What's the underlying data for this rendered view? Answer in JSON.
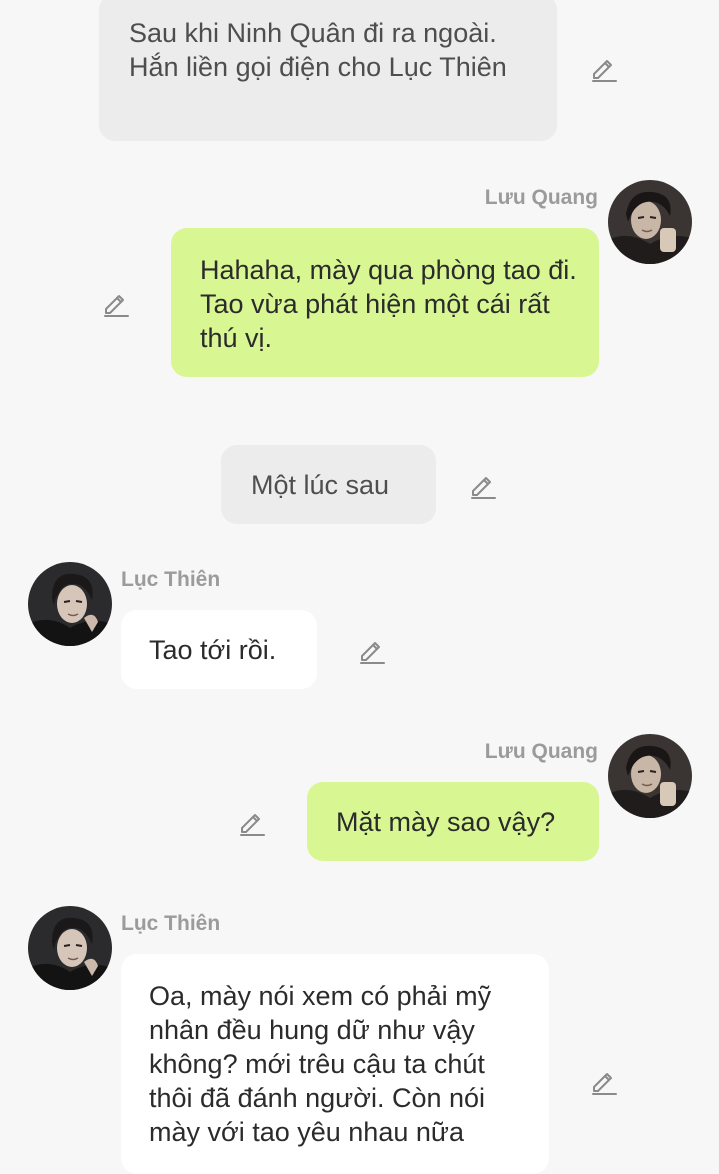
{
  "messages": [
    {
      "id": "narration-1",
      "type": "narration",
      "text": "Sau khi Ninh Quân đi ra ngoài. Hắn liền gọi điện cho Lục Thiên"
    },
    {
      "id": "msg-1",
      "type": "outgoing",
      "sender": "Lưu Quang",
      "text": "Hahaha, mày qua phòng tao đi. Tao vừa phát hiện một cái rất thú vị."
    },
    {
      "id": "narration-2",
      "type": "narration",
      "text": "Một lúc sau"
    },
    {
      "id": "msg-2",
      "type": "incoming",
      "sender": "Lục Thiên",
      "text": "Tao tới rồi."
    },
    {
      "id": "msg-3",
      "type": "outgoing",
      "sender": "Lưu Quang",
      "text": "Mặt mày sao vậy?"
    },
    {
      "id": "msg-4",
      "type": "incoming",
      "sender": "Lục Thiên",
      "text": "Oa, mày nói xem có phải mỹ nhân đều hung dữ như vậy không? mới trêu cậu ta chút thôi đã đánh người. Còn nói mày với tao yêu nhau nữa"
    }
  ],
  "icons": {
    "edit": "pencil-edit-icon",
    "avatar_luu_quang": "avatar-luu-quang",
    "avatar_luc_thien": "avatar-luc-thien"
  },
  "colors": {
    "background": "#f7f7f7",
    "narration_bubble": "#ececec",
    "outgoing_bubble": "#d8f793",
    "incoming_bubble": "#ffffff",
    "sender_name": "#9b9b9b"
  }
}
